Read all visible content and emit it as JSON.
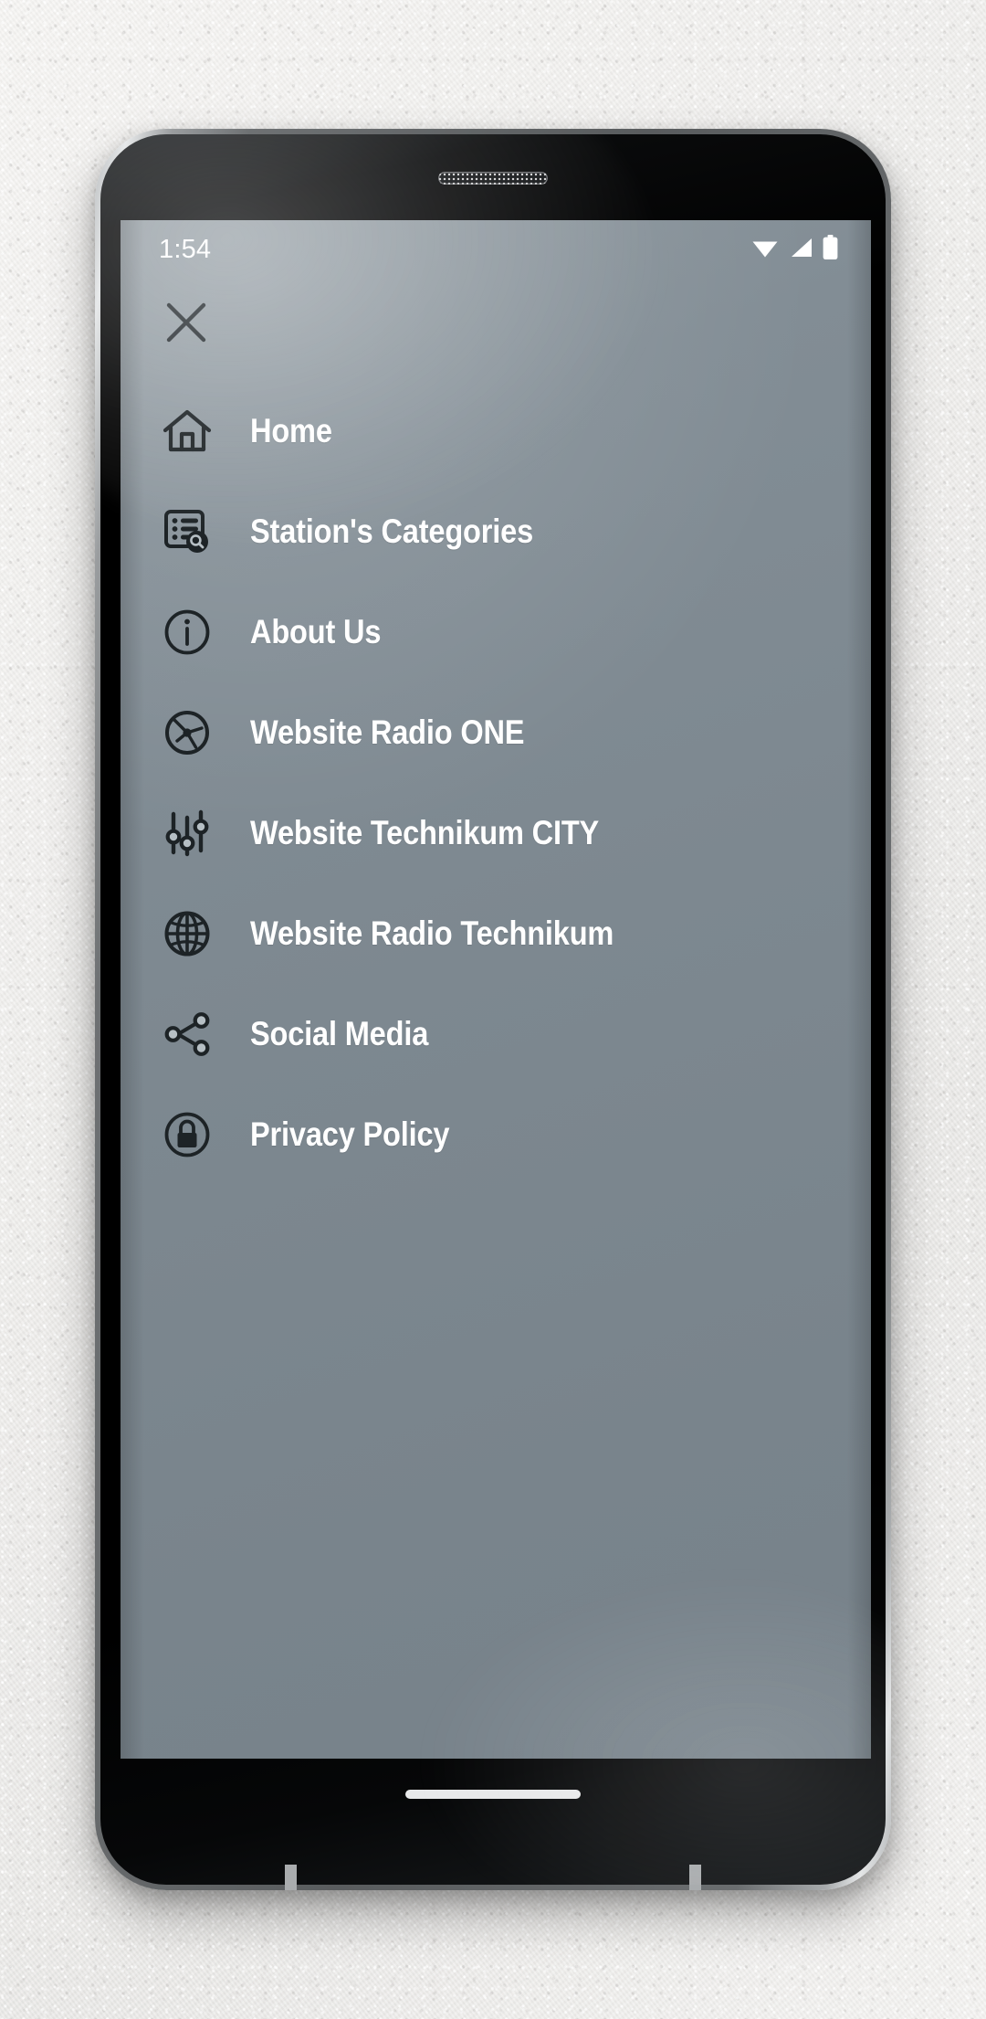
{
  "device": {
    "type": "android-smartphone",
    "earpiece": "earpiece-speaker"
  },
  "status_bar": {
    "time": "1:54",
    "icons": [
      {
        "name": "wifi-icon",
        "label": "Wi-Fi"
      },
      {
        "name": "cellular-signal-icon",
        "label": "Cellular signal"
      },
      {
        "name": "battery-icon",
        "label": "Battery"
      }
    ]
  },
  "drawer": {
    "close_label": "Close",
    "background_color": "#7d8890",
    "text_color": "#ffffff",
    "icon_color": "#1d2326",
    "items": [
      {
        "label": "Home",
        "icon": "home-icon"
      },
      {
        "label": "Station's Categories",
        "icon": "list-search-icon"
      },
      {
        "label": "About Us",
        "icon": "info-circle-icon"
      },
      {
        "label": "Website Radio ONE",
        "icon": "disc-icon"
      },
      {
        "label": "Website Technikum CITY",
        "icon": "equalizer-sliders-icon"
      },
      {
        "label": "Website Radio Technikum",
        "icon": "globe-icon"
      },
      {
        "label": "Social Media",
        "icon": "share-icon"
      },
      {
        "label": "Privacy Policy",
        "icon": "lock-circle-icon"
      }
    ]
  },
  "navigation_bar": {
    "home_indicator": "home-gesture-bar"
  }
}
